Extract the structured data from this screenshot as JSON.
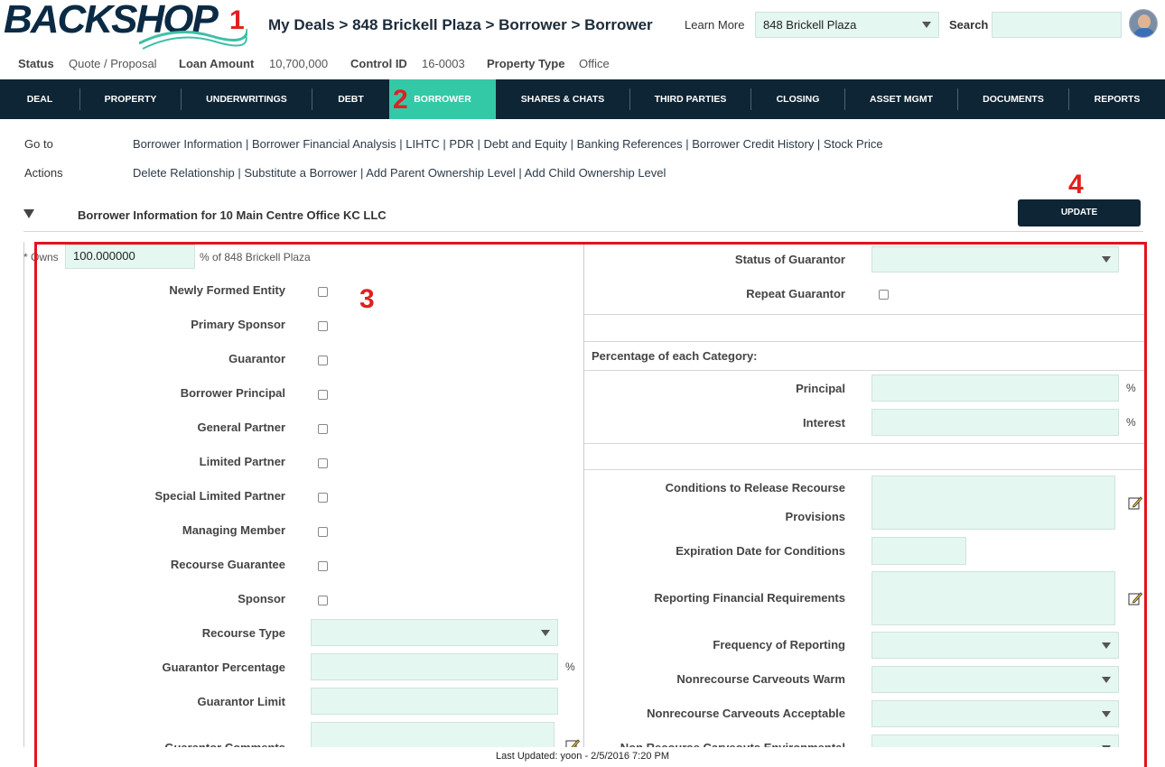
{
  "logo": {
    "text": "BACKSHOP"
  },
  "annotations": {
    "n1": "1",
    "n2": "2",
    "n3": "3",
    "n4": "4"
  },
  "breadcrumb": "My Deals > 848 Brickell Plaza > Borrower > Borrower",
  "header": {
    "learn_more": "Learn More",
    "deal_select": "848 Brickell Plaza",
    "search_label": "Search",
    "search_value": ""
  },
  "info": {
    "status_label": "Status",
    "status_value": "Quote / Proposal",
    "loan_label": "Loan Amount",
    "loan_value": "10,700,000",
    "control_label": "Control ID",
    "control_value": "16-0003",
    "ptype_label": "Property Type",
    "ptype_value": "Office"
  },
  "nav": [
    "DEAL",
    "PROPERTY",
    "UNDERWRITINGS",
    "DEBT",
    "BORROWER",
    "SHARES & CHATS",
    "THIRD PARTIES",
    "CLOSING",
    "ASSET MGMT",
    "DOCUMENTS",
    "REPORTS"
  ],
  "nav_active": "BORROWER",
  "goto": {
    "label": "Go to",
    "links": "Borrower Information | Borrower Financial Analysis | LIHTC | PDR | Debt and Equity | Banking References | Borrower Credit History | Stock Price"
  },
  "actions": {
    "label": "Actions",
    "links": "Delete Relationship | Substitute a Borrower | Add Parent Ownership Level | Add Child Ownership Level"
  },
  "section": {
    "title": "Borrower Information for 10 Main Centre Office KC LLC",
    "update": "UPDATE"
  },
  "owns": {
    "label": "* Owns",
    "value": "100.000000",
    "suffix": "% of 848 Brickell Plaza"
  },
  "left_checkboxes": [
    "Newly Formed Entity",
    "Primary Sponsor",
    "Guarantor",
    "Borrower Principal",
    "General Partner",
    "Limited Partner",
    "Special Limited Partner",
    "Managing Member",
    "Recourse Guarantee",
    "Sponsor"
  ],
  "left_fields": {
    "recourse_type": "Recourse Type",
    "guarantor_percentage": "Guarantor Percentage",
    "guarantor_limit": "Guarantor Limit",
    "guarantor_comments": "Guarantor Comments",
    "pct": "%"
  },
  "right": {
    "status_of_guarantor": "Status of Guarantor",
    "repeat_guarantor": "Repeat Guarantor",
    "pct_category": "Percentage of each Category:",
    "principal": "Principal",
    "interest": "Interest",
    "pct": "%",
    "conditions_1": "Conditions to Release Recourse",
    "conditions_2": "Provisions",
    "expiration": "Expiration Date for Conditions",
    "reporting": "Reporting Financial Requirements",
    "frequency": "Frequency of Reporting",
    "warm": "Nonrecourse Carveouts Warm",
    "acceptable": "Nonrecourse Carveouts Acceptable",
    "environmental": "Non Recourse Carveouts Environmental"
  },
  "footer": "Last Updated: yoon - 2/5/2016 7:20 PM"
}
